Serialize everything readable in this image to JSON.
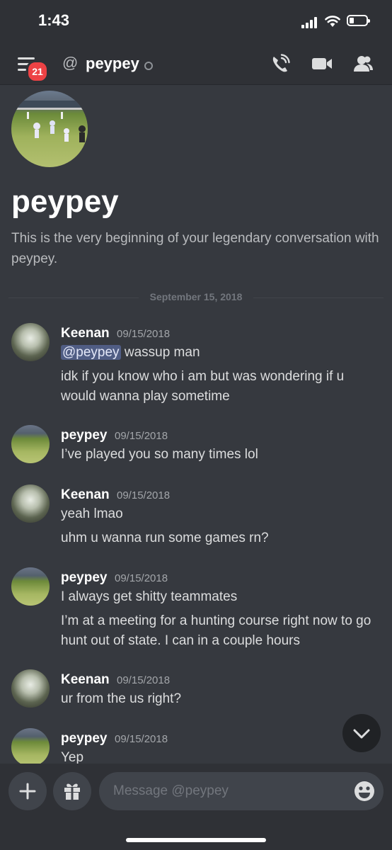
{
  "status_bar": {
    "time": "1:43"
  },
  "header": {
    "notification_count": "21",
    "at_symbol": "@",
    "channel_name": "peypey"
  },
  "intro": {
    "title": "peypey",
    "text": "This is the very beginning of your legendary conversation with peypey."
  },
  "divider": {
    "date": "September 15, 2018"
  },
  "messages": [
    {
      "author": "Keenan",
      "timestamp": "09/15/2018",
      "mention": "@peypey",
      "lines": [
        "wassup man",
        "idk if you know who i am but was wondering if u would wanna play sometime"
      ]
    },
    {
      "author": "peypey",
      "timestamp": "09/15/2018",
      "lines": [
        "I’ve played you so many times lol"
      ]
    },
    {
      "author": "Keenan",
      "timestamp": "09/15/2018",
      "lines": [
        "yeah lmao",
        "uhm u wanna run some games rn?"
      ]
    },
    {
      "author": "peypey",
      "timestamp": "09/15/2018",
      "lines": [
        "I always get shitty teammates",
        "I’m at a meeting for a hunting course right now to go hunt out of state. I can in a couple hours"
      ]
    },
    {
      "author": "Keenan",
      "timestamp": "09/15/2018",
      "lines": [
        "ur from the us right?"
      ]
    },
    {
      "author": "peypey",
      "timestamp": "09/15/2018",
      "lines": [
        "Yep"
      ]
    }
  ],
  "composer": {
    "placeholder": "Message @peypey"
  },
  "colors": {
    "background": "#36393f",
    "header": "#2f3136",
    "badge": "#ed4245",
    "mention": "#7289da"
  },
  "icons": [
    "menu-icon",
    "at-icon",
    "call-icon",
    "video-icon",
    "members-icon",
    "plus-icon",
    "gift-icon",
    "emoji-icon",
    "chevron-down-icon"
  ]
}
